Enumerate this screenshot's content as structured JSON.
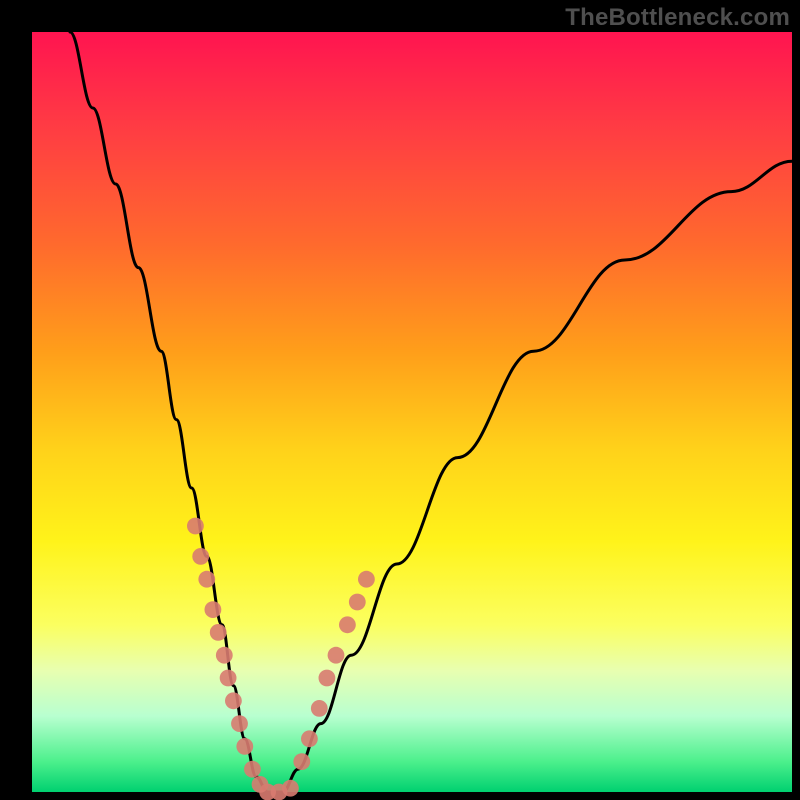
{
  "watermark": "TheBottleneck.com",
  "chart_data": {
    "type": "line",
    "title": "",
    "xlabel": "",
    "ylabel": "",
    "xlim": [
      0,
      100
    ],
    "ylim": [
      0,
      100
    ],
    "grid": false,
    "legend": false,
    "series": [
      {
        "name": "bottleneck-curve",
        "x": [
          5,
          8,
          11,
          14,
          17,
          19,
          21,
          23,
          25,
          26.5,
          28,
          29.5,
          31,
          33,
          35,
          38,
          42,
          48,
          56,
          66,
          78,
          92,
          100
        ],
        "y": [
          100,
          90,
          80,
          69,
          58,
          49,
          40,
          31,
          22,
          14,
          7,
          2,
          0,
          0,
          3,
          9,
          18,
          30,
          44,
          58,
          70,
          79,
          83
        ],
        "color": "#000000"
      }
    ],
    "markers": [
      {
        "name": "sample-points",
        "color": "#d87b70",
        "radius": 1.1,
        "points": [
          {
            "x": 21.5,
            "y": 35
          },
          {
            "x": 22.2,
            "y": 31
          },
          {
            "x": 23.0,
            "y": 28
          },
          {
            "x": 23.8,
            "y": 24
          },
          {
            "x": 24.5,
            "y": 21
          },
          {
            "x": 25.3,
            "y": 18
          },
          {
            "x": 25.8,
            "y": 15
          },
          {
            "x": 26.5,
            "y": 12
          },
          {
            "x": 27.3,
            "y": 9
          },
          {
            "x": 28.0,
            "y": 6
          },
          {
            "x": 29.0,
            "y": 3
          },
          {
            "x": 30.0,
            "y": 1
          },
          {
            "x": 31.0,
            "y": 0
          },
          {
            "x": 32.5,
            "y": 0
          },
          {
            "x": 34.0,
            "y": 0.5
          },
          {
            "x": 35.5,
            "y": 4
          },
          {
            "x": 36.5,
            "y": 7
          },
          {
            "x": 37.8,
            "y": 11
          },
          {
            "x": 38.8,
            "y": 15
          },
          {
            "x": 40.0,
            "y": 18
          },
          {
            "x": 41.5,
            "y": 22
          },
          {
            "x": 42.8,
            "y": 25
          },
          {
            "x": 44.0,
            "y": 28
          }
        ]
      }
    ]
  }
}
